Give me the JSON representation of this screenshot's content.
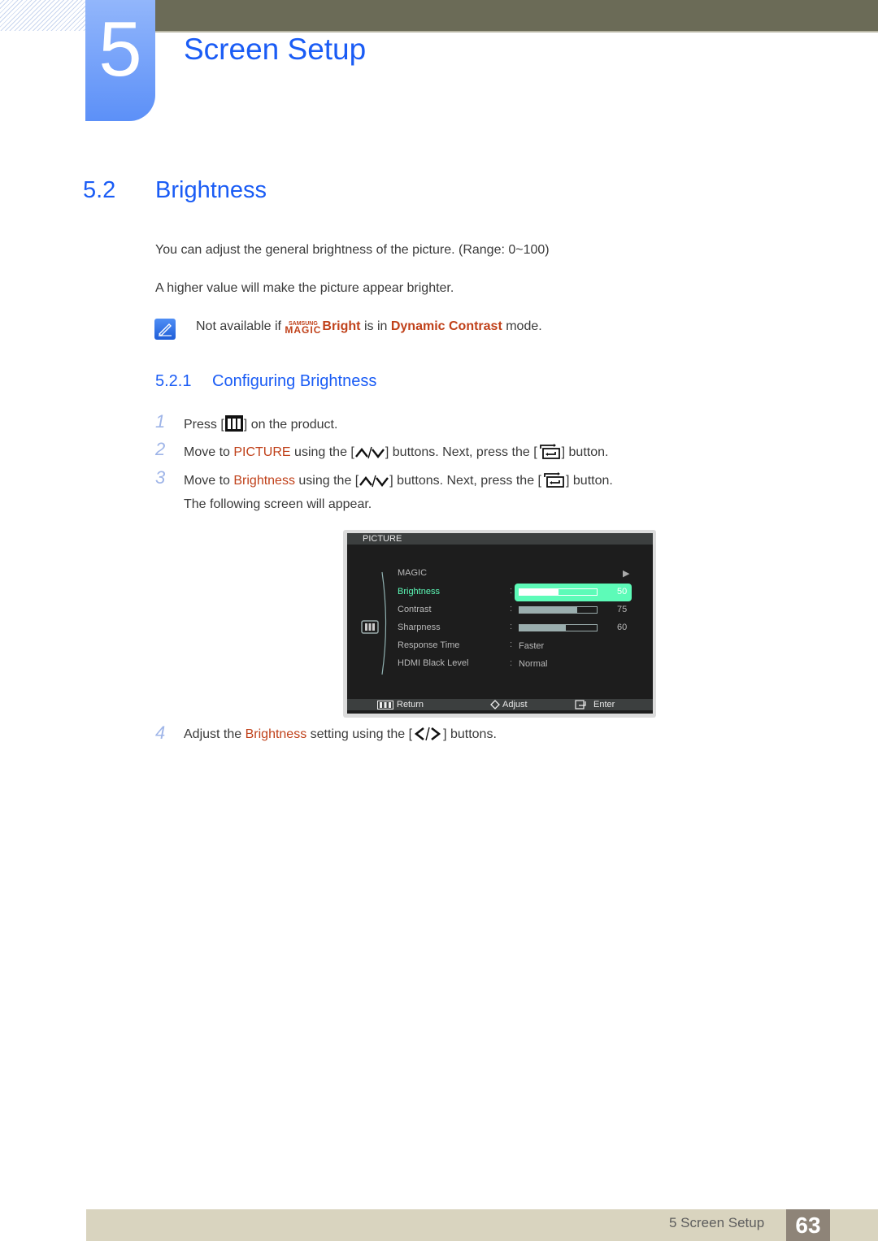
{
  "chapter": {
    "number": "5",
    "title": "Screen Setup"
  },
  "section": {
    "number": "5.2",
    "title": "Brightness"
  },
  "intro": [
    "You can adjust the general brightness of the picture. (Range: 0~100)",
    "A higher value will make the picture appear brighter."
  ],
  "note": {
    "icon": "note-pen-icon",
    "prefix": "Not available if ",
    "magic_small": "SAMSUNG",
    "magic_big": "MAGIC",
    "magic_word": "Bright",
    "middle": " is in ",
    "highlight": "Dynamic Contrast",
    "suffix": " mode."
  },
  "subsection": {
    "number": "5.2.1",
    "title": "Configuring Brightness"
  },
  "steps": [
    {
      "n": "1",
      "a": "Press [",
      "b": "] on the product."
    },
    {
      "n": "2",
      "a": "Move to ",
      "hl": "PICTURE",
      "b": " using the [",
      "c": "] buttons. Next, press the [",
      "d": "] button."
    },
    {
      "n": "3",
      "a": "Move to ",
      "hl": "Brightness",
      "b": " using the [",
      "c": "] buttons. Next, press the [",
      "d": "] button."
    },
    {
      "extra": "The following screen will appear."
    },
    {
      "n": "4",
      "a": "Adjust the ",
      "hl": "Brightness",
      "b": " setting using the [",
      "c": "] buttons."
    }
  ],
  "osd": {
    "title": "PICTURE",
    "items": [
      {
        "label": "MAGIC",
        "arrow": "▶"
      },
      {
        "label": "Brightness",
        "value": "50",
        "level": 50,
        "selected": true
      },
      {
        "label": "Contrast",
        "value": "75",
        "level": 75
      },
      {
        "label": "Sharpness",
        "value": "60",
        "level": 60
      },
      {
        "label": "Response Time",
        "text": "Faster"
      },
      {
        "label": "HDMI Black Level",
        "text": "Normal"
      }
    ],
    "footer": {
      "return": "Return",
      "adjust": "Adjust",
      "enter": "Enter"
    }
  },
  "footer": {
    "label": "5 Screen Setup",
    "page": "63"
  },
  "colors": {
    "heading": "#1a5cf5",
    "highlight": "#c0411a",
    "osd_selected": "#5dfbb8"
  }
}
